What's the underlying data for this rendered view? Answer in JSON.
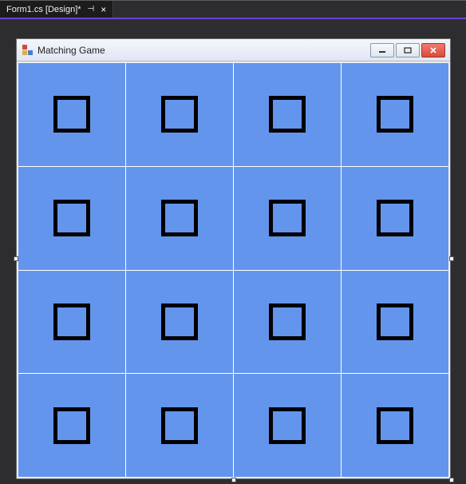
{
  "tab": {
    "label": "Form1.cs [Design]*",
    "modified": true
  },
  "form": {
    "title": "Matching Game",
    "grid_rows": 4,
    "grid_cols": 4,
    "cell_color": "#6495ed"
  }
}
